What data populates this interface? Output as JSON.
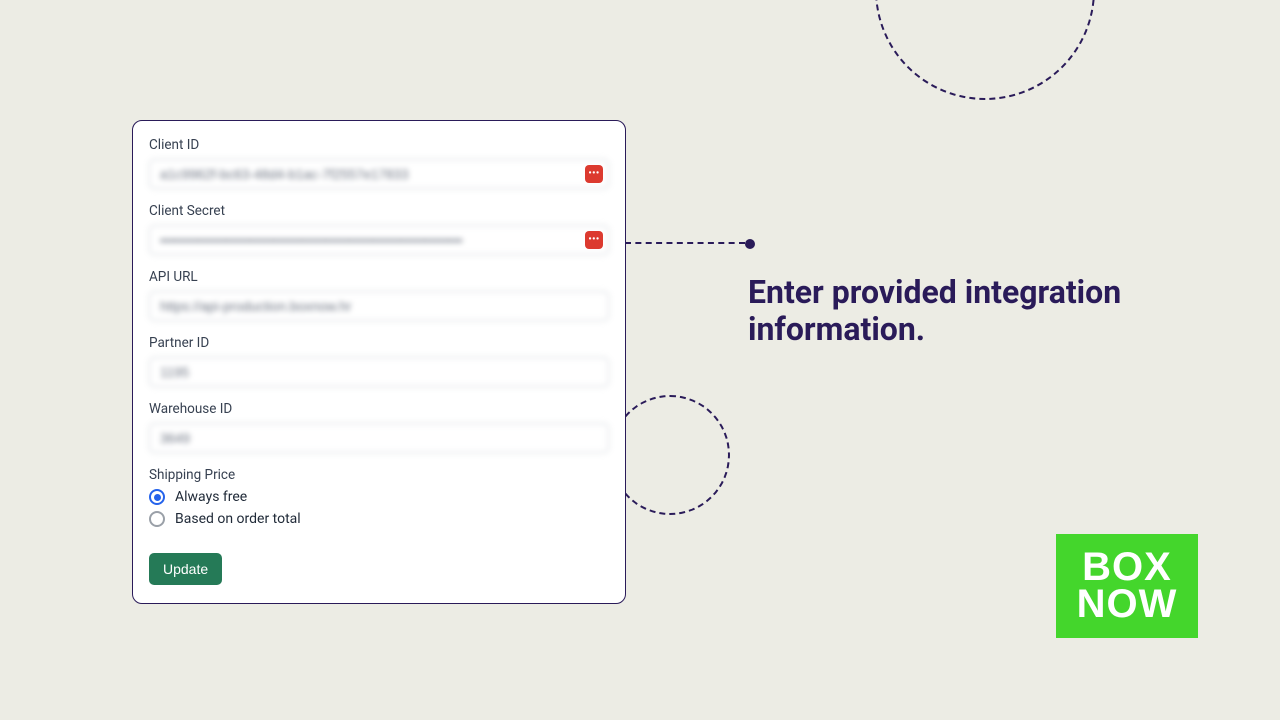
{
  "form": {
    "client_id": {
      "label": "Client ID",
      "value": "a1c9962f-bc63-48d4-b1ac-7f2557e17833"
    },
    "client_secret": {
      "label": "Client Secret",
      "value": "••••••••••••••••••••••••••••••••••••••••••••••••••••••••••••••••"
    },
    "api_url": {
      "label": "API URL",
      "value": "https://api-production.boxnow.hr"
    },
    "partner_id": {
      "label": "Partner ID",
      "value": "1195"
    },
    "warehouse_id": {
      "label": "Warehouse ID",
      "value": "3649"
    },
    "shipping_price_label": "Shipping Price",
    "shipping_options": {
      "always_free": {
        "label": "Always free",
        "checked": true
      },
      "based_on_total": {
        "label": "Based on order total",
        "checked": false
      }
    },
    "submit_label": "Update"
  },
  "headline": "Enter provided integration information.",
  "logo": {
    "line1": "BOX",
    "line2": "NOW"
  },
  "icons": {
    "password_extension": "•••"
  },
  "colors": {
    "accent": "#2a1b59",
    "brand_green": "#44d62c",
    "button_green": "#257a57",
    "extension_red": "#dc3a2f"
  }
}
